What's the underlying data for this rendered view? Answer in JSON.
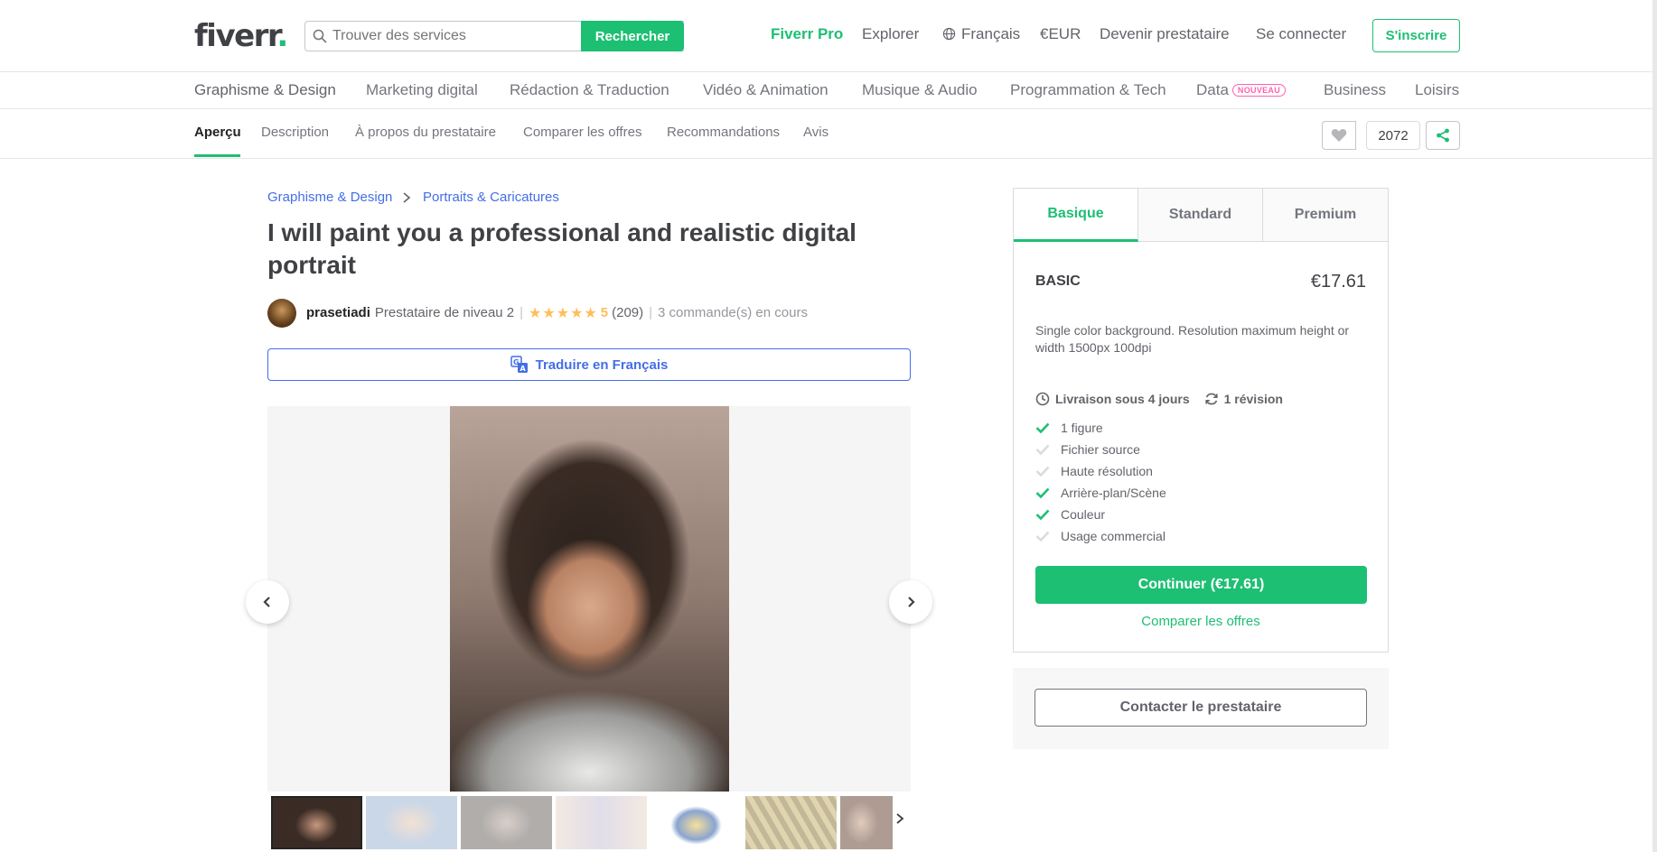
{
  "header": {
    "logo": "fiverr",
    "logo_dot": ".",
    "search_placeholder": "Trouver des services",
    "search_button": "Rechercher",
    "fiverr_pro": "Fiverr Pro",
    "explore": "Explorer",
    "language": "Français",
    "currency": "€EUR",
    "become_seller": "Devenir prestataire",
    "sign_in": "Se connecter",
    "join": "S'inscrire"
  },
  "categories": {
    "items": [
      "Graphisme & Design",
      "Marketing digital",
      "Rédaction & Traduction",
      "Vidéo & Animation",
      "Musique & Audio",
      "Programmation & Tech",
      "Data",
      "Business",
      "Loisirs"
    ],
    "new_badge": "NOUVEAU"
  },
  "tabs": {
    "items": [
      "Aperçu",
      "Description",
      "À propos du prestataire",
      "Comparer les offres",
      "Recommandations",
      "Avis"
    ],
    "likes_count": "2072"
  },
  "breadcrumb": [
    "Graphisme & Design",
    "Portraits & Caricatures"
  ],
  "gig": {
    "title": "I will paint you a professional and realistic digital portrait",
    "seller_name": "prasetiadi",
    "seller_level": "Prestataire de niveau 2",
    "stars": "★★★★★",
    "rating": "5",
    "review_count": "(209)",
    "orders_in_queue": "3 commande(s) en cours",
    "translate_button": "Traduire en Français"
  },
  "package": {
    "tabs": [
      "Basique",
      "Standard",
      "Premium"
    ],
    "name": "BASIC",
    "price": "€17.61",
    "description": "Single color background. Resolution maximum height or width 1500px 100dpi",
    "delivery": "Livraison sous 4 jours",
    "revisions": "1 révision",
    "features": [
      {
        "label": "1 figure",
        "included": true
      },
      {
        "label": "Fichier source",
        "included": false
      },
      {
        "label": "Haute résolution",
        "included": false
      },
      {
        "label": "Arrière-plan/Scène",
        "included": true
      },
      {
        "label": "Couleur",
        "included": true
      },
      {
        "label": "Usage commercial",
        "included": false
      }
    ],
    "continue_button": "Continuer (€17.61)",
    "compare_link": "Comparer les offres",
    "contact_button": "Contacter le prestataire"
  },
  "colors": {
    "brand_green": "#1dbf73",
    "link_blue": "#446ee7",
    "star_yellow": "#ffbe5b",
    "new_badge_pink": "#ff62ad"
  }
}
